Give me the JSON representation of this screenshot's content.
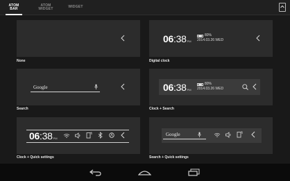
{
  "tabs": [
    {
      "label": "ATOM BAR",
      "active": true
    },
    {
      "label": "ATOM WIDGET",
      "active": false
    },
    {
      "label": "WIDGET",
      "active": false
    }
  ],
  "clock": {
    "hour": "06",
    "minute": "38",
    "ampm": "PM",
    "battery": "80%",
    "date": "2014.03.26",
    "weekday": "WED"
  },
  "search_text": "Google",
  "options": [
    {
      "caption": "None"
    },
    {
      "caption": "Digital clock"
    },
    {
      "caption": "Search"
    },
    {
      "caption": "Clock + Search"
    },
    {
      "caption": "Clock + Quick settings"
    },
    {
      "caption": "Search + Quick settings"
    }
  ],
  "icons": {
    "top_right": "mini-window-icon",
    "back": "back-icon",
    "home": "home-icon",
    "recents": "recents-icon",
    "chevron": "chevron-left-icon",
    "wifi": "wifi-icon",
    "sound": "sound-icon",
    "rotate": "rotation-lock-icon",
    "bluetooth": "bluetooth-icon",
    "brightness": "brightness-icon",
    "mic": "mic-icon",
    "search_zoom": "search-icon"
  }
}
